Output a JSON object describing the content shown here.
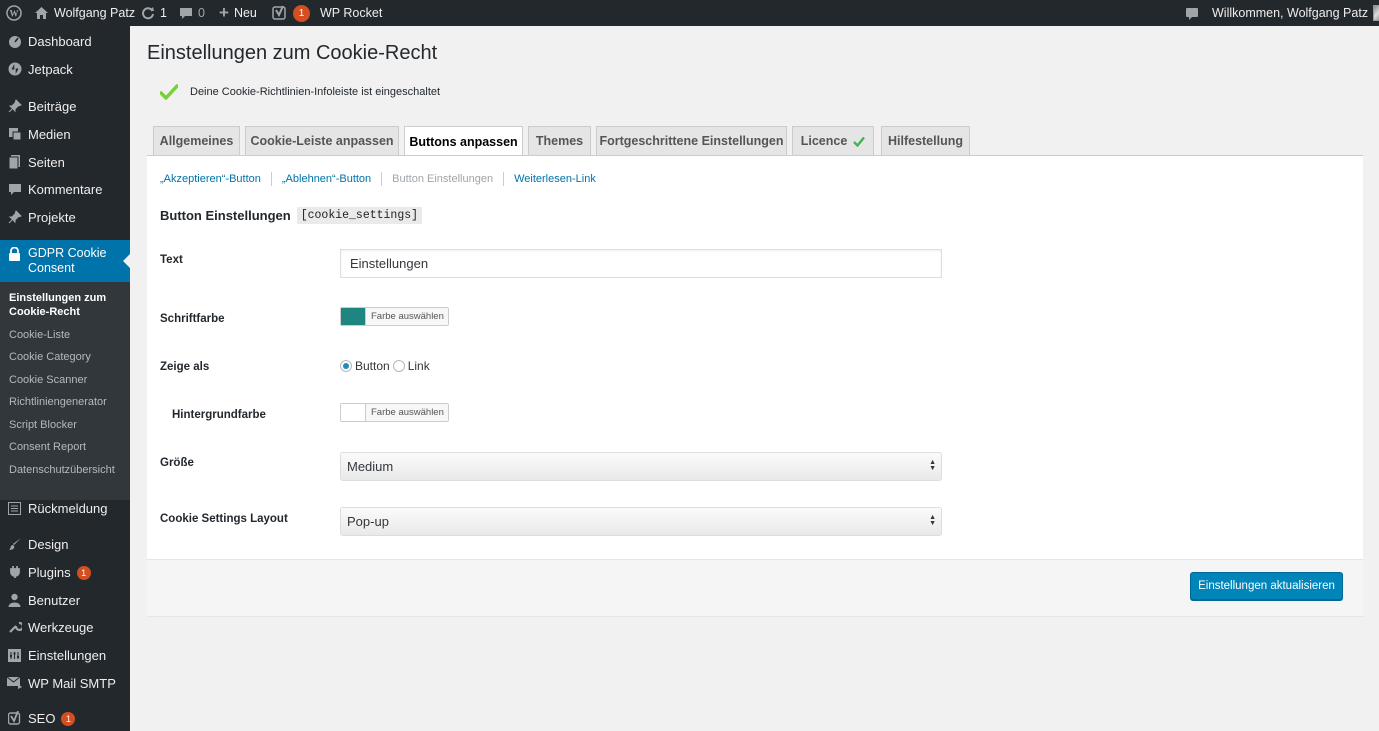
{
  "adminbar": {
    "site_name": "Wolfgang Patz",
    "updates_count": "1",
    "comments_count": "0",
    "new_label": "Neu",
    "yoast_badge": "1",
    "wp_rocket": "WP Rocket",
    "welcome": "Willkommen, Wolfgang Patz"
  },
  "sidebar": {
    "items": [
      {
        "label": "Dashboard",
        "icon": "dashboard-icon"
      },
      {
        "label": "Jetpack",
        "icon": "jetpack-icon"
      },
      {
        "label": "Beiträge",
        "icon": "pin-icon"
      },
      {
        "label": "Medien",
        "icon": "media-icon"
      },
      {
        "label": "Seiten",
        "icon": "page-icon"
      },
      {
        "label": "Kommentare",
        "icon": "comment-icon"
      },
      {
        "label": "Projekte",
        "icon": "pin-icon"
      },
      {
        "label": "GDPR Cookie Consent",
        "icon": "lock-icon"
      },
      {
        "label": "Rückmeldung",
        "icon": "feedback-icon"
      },
      {
        "label": "Design",
        "icon": "brush-icon"
      },
      {
        "label": "Plugins",
        "icon": "plugin-icon",
        "badge": "1"
      },
      {
        "label": "Benutzer",
        "icon": "user-icon"
      },
      {
        "label": "Werkzeuge",
        "icon": "wrench-icon"
      },
      {
        "label": "Einstellungen",
        "icon": "settings-icon"
      },
      {
        "label": "WP Mail SMTP",
        "icon": "mail-icon"
      },
      {
        "label": "SEO",
        "icon": "yoast-icon",
        "badge": "1"
      }
    ],
    "submenu": [
      "Einstellungen zum Cookie-Recht",
      "Cookie-Liste",
      "Cookie Category",
      "Cookie Scanner",
      "Richtliniengenerator",
      "Script Blocker",
      "Consent Report",
      "Datenschutzübersicht"
    ]
  },
  "page": {
    "title": "Einstellungen zum Cookie-Recht",
    "notice": "Deine Cookie-Richtlinien-Infoleiste ist eingeschaltet"
  },
  "tabs": [
    "Allgemeines",
    "Cookie-Leiste anpassen",
    "Buttons anpassen",
    "Themes",
    "Fortgeschrittene Einstellungen",
    "Licence",
    "Hilfestellung"
  ],
  "active_tab": "Buttons anpassen",
  "subnav": [
    "„Akzeptieren“-Button",
    "„Ablehnen“-Button",
    "Button Einstellungen",
    "Weiterlesen-Link"
  ],
  "section": {
    "title": "Button Einstellungen",
    "shortcode": "[cookie_settings]"
  },
  "form": {
    "text_label": "Text",
    "text_value": "Einstellungen",
    "fontcolor_label": "Schriftfarbe",
    "fontcolor_button": "Farbe auswählen",
    "fontcolor_value": "#1e8580",
    "showas_label": "Zeige als",
    "showas_options": [
      "Button",
      "Link"
    ],
    "showas_selected": "Button",
    "bgcolor_label": "Hintergrundfarbe",
    "bgcolor_button": "Farbe auswählen",
    "bgcolor_value": "#ffffff",
    "size_label": "Größe",
    "size_value": "Medium",
    "layout_label": "Cookie Settings Layout",
    "layout_value": "Pop-up"
  },
  "save_button": "Einstellungen aktualisieren",
  "colors": {
    "accent": "#0073aa",
    "primary_button": "#0085ba",
    "success": "#46b450",
    "badge": "#d54e21"
  }
}
